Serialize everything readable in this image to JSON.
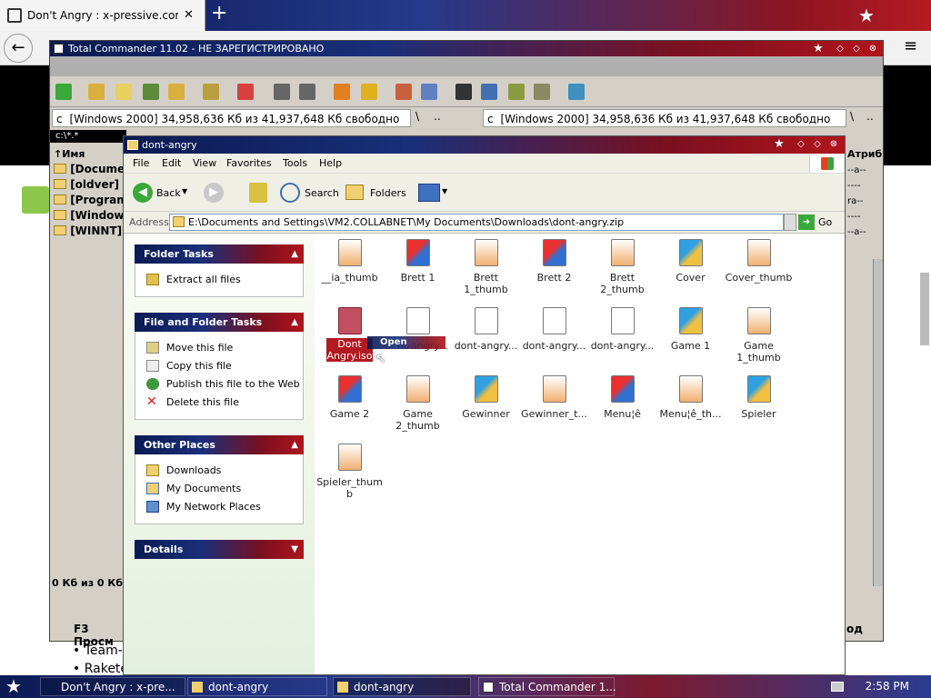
{
  "browser": {
    "tab_title": "Don't Angry : x-pressive.com, con",
    "new_tab_glyph": "+",
    "close_glyph": "✕"
  },
  "total_commander": {
    "title": "Total Commander 11.02 - НЕ ЗАРЕГИСТРИРОВАНО",
    "left_drive": "c",
    "left_drive_info": "[Windows 2000]  34,958,636 Кб из 41,937,648 Кб свободно",
    "right_drive": "c",
    "right_drive_info": "[Windows 2000]  34,958,636 Кб из 41,937,648 Кб свободно",
    "root_glyph": "\\",
    "up_glyph": "..",
    "left_path": "c:\\*.*",
    "column_name": "↑Имя",
    "column_attr": "Атриб",
    "left_items": [
      "[Document",
      "[oldver]",
      "[Program F",
      "[Windows]",
      "[WINNT]"
    ],
    "right_attr_values": [
      "--a--",
      "----",
      "ra--",
      "----",
      "--a--"
    ],
    "status_left": "0 Кб из 0 Кб,",
    "fkey_f3": "F3 Просм",
    "fkey_right": "од"
  },
  "page_bullets": [
    "• Team-C",
    "• Rakete"
  ],
  "explorer": {
    "title": "dont-angry",
    "menu": [
      "File",
      "Edit",
      "View",
      "Favorites",
      "Tools",
      "Help"
    ],
    "toolbar": {
      "back": "Back",
      "search": "Search",
      "folders": "Folders"
    },
    "address_label": "Address",
    "address_value": "E:\\Documents and Settings\\VM2.COLLABNET\\My Documents\\Downloads\\dont-angry.zip",
    "go_label": "Go",
    "panels": {
      "folder_tasks": {
        "title": "Folder Tasks",
        "items": [
          "Extract all files"
        ]
      },
      "file_tasks": {
        "title": "File and Folder Tasks",
        "items": [
          "Move this file",
          "Copy this file",
          "Publish this file to the Web",
          "Delete this file"
        ]
      },
      "other_places": {
        "title": "Other Places",
        "items": [
          "Downloads",
          "My Documents",
          "My Network Places"
        ]
      },
      "details": {
        "title": "Details"
      }
    },
    "files": [
      "__ia_thumb",
      "Brett 1",
      "Brett 1_thumb",
      "Brett 2",
      "Brett 2_thumb",
      "Cover",
      "Cover_thumb",
      "Dont Angry.iso",
      "...nt-angry...",
      "dont-angry...",
      "dont-angry...",
      "dont-angry...",
      "Game 1",
      "Game 1_thumb",
      "Game 2",
      "Game 2_thumb",
      "Gewinner",
      "Gewinner_t...",
      "Menu¦ê",
      "Menu¦ê_th...",
      "Spieler",
      "Spieler_thumb"
    ],
    "drag_tooltip": "Open"
  },
  "taskbar": {
    "tasks": [
      "Don't Angry : x-pre...",
      "dont-angry",
      "dont-angry",
      "Total Commander 1..."
    ],
    "clock": "2:58 PM"
  }
}
